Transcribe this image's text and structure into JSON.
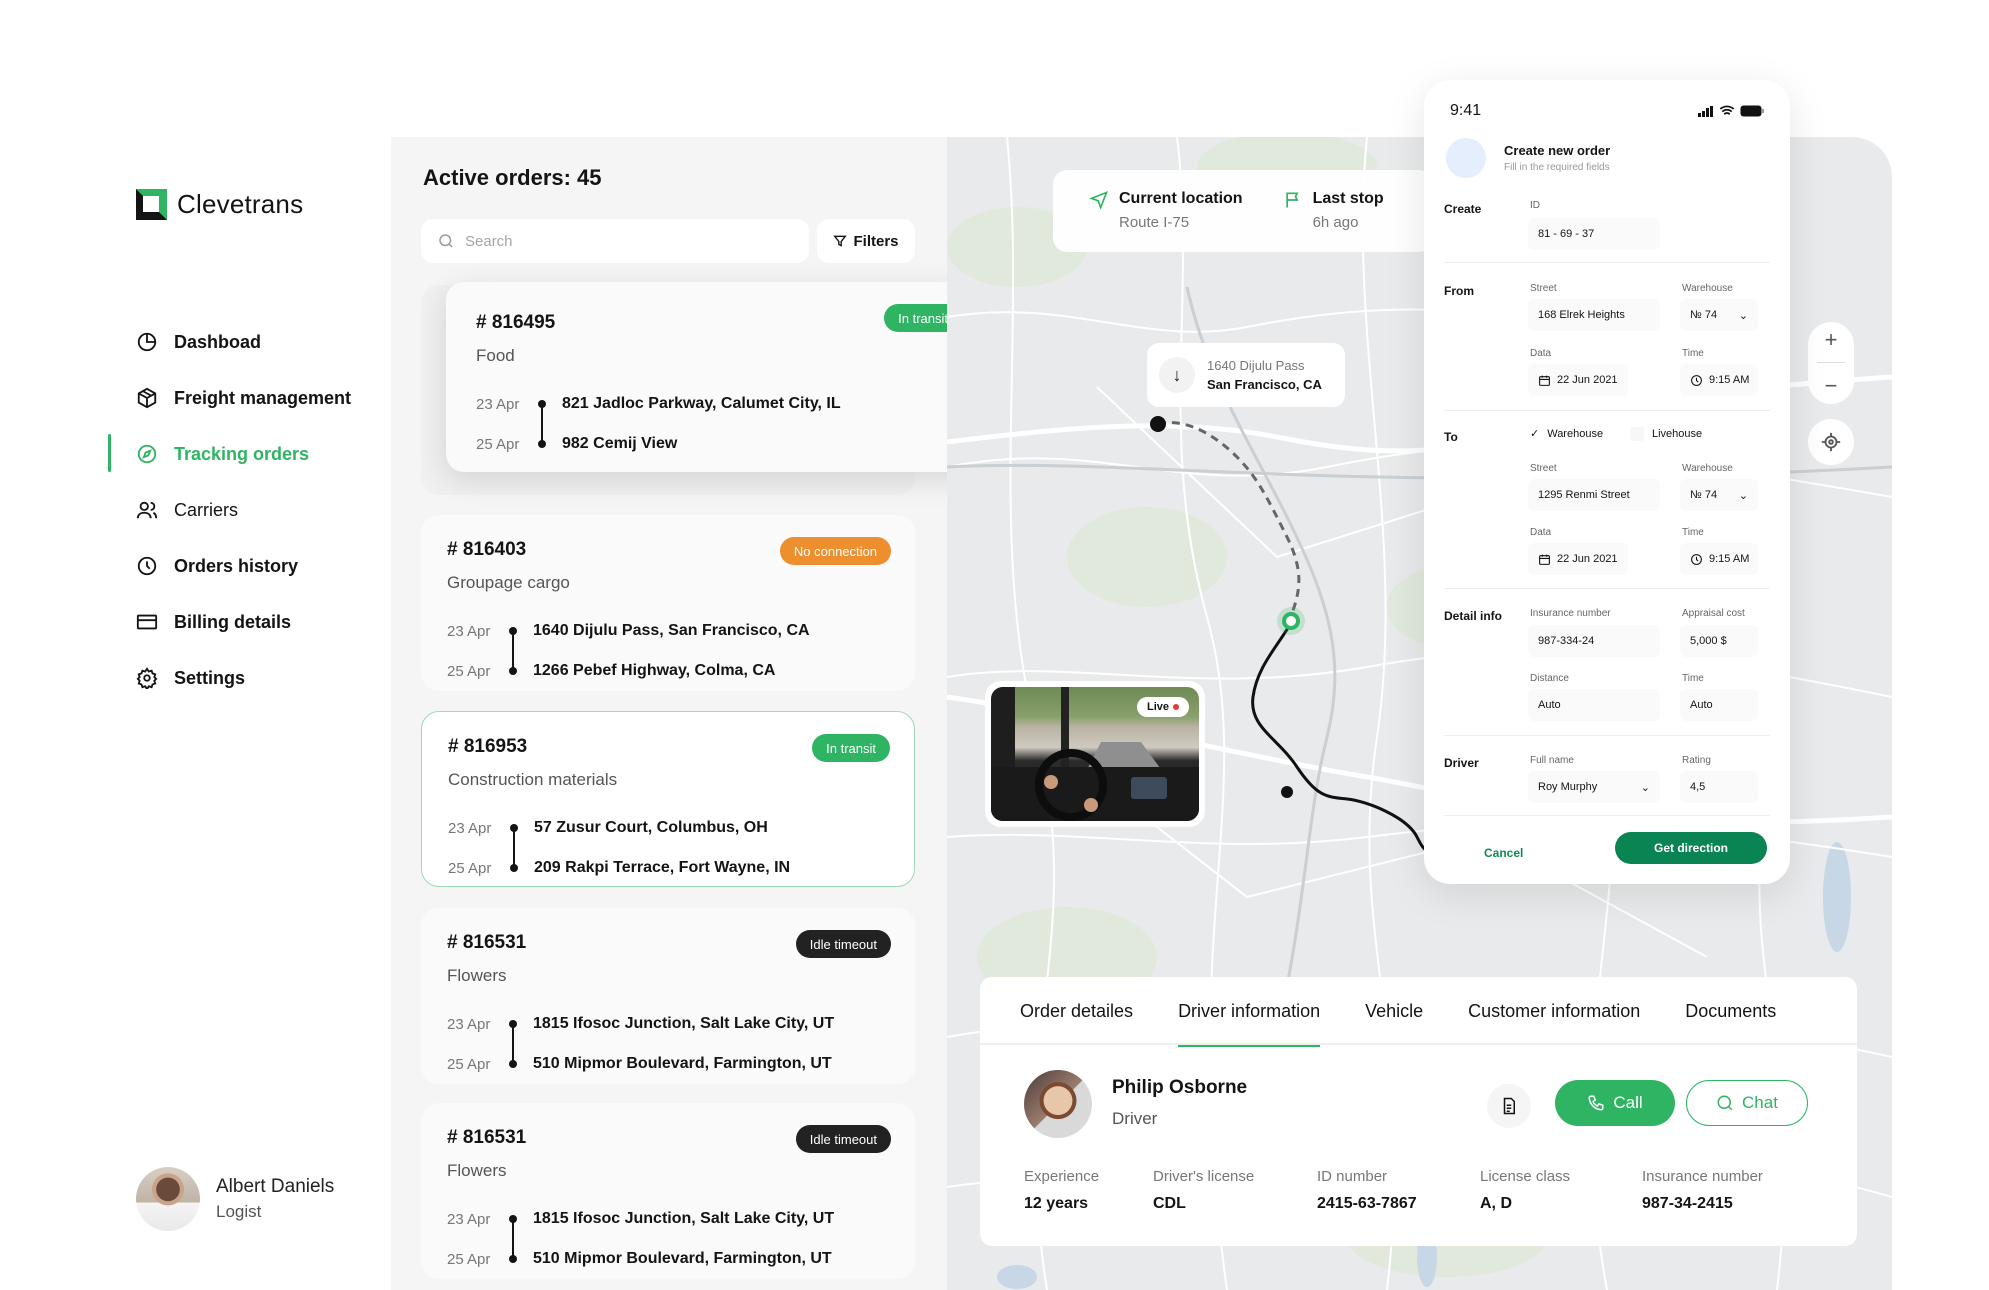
{
  "app": {
    "name": "Clevetrans",
    "brand_color": "#2fb463",
    "dark_color": "#141414"
  },
  "sidebar": {
    "items": [
      {
        "label": "Dashboad",
        "icon": "pie-chart-icon",
        "active": false
      },
      {
        "label": "Freight management",
        "icon": "box-icon",
        "active": false
      },
      {
        "label": "Tracking orders",
        "icon": "compass-icon",
        "active": true
      },
      {
        "label": "Carriers",
        "icon": "users-icon",
        "active": false
      },
      {
        "label": "Orders history",
        "icon": "clock-icon",
        "active": false
      },
      {
        "label": "Billing details",
        "icon": "credit-card-icon",
        "active": false
      },
      {
        "label": "Settings",
        "icon": "gear-icon",
        "active": false
      }
    ],
    "user": {
      "name": "Albert Daniels",
      "role": "Logist"
    }
  },
  "orders": {
    "title": "Active orders: 45",
    "search_placeholder": "Search",
    "search_value": "",
    "filters_label": "Filters",
    "list": [
      {
        "number": "# 816495",
        "cargo": "Food",
        "status": "In transit",
        "status_color": "#2fb463",
        "from_date": "23 Apr",
        "from_addr": "821 Jadloc Parkway, Calumet City, IL",
        "to_date": "25 Apr",
        "to_addr": "982 Cemij View"
      },
      {
        "number": "# 816403",
        "cargo": "Groupage cargo",
        "status": "No connection",
        "status_color": "#ed8f2f",
        "from_date": "23 Apr",
        "from_addr": "1640 Dijulu Pass, San Francisco, CA",
        "to_date": "25 Apr",
        "to_addr": "1266 Pebef Highway, Colma,  CA"
      },
      {
        "number": "# 816953",
        "cargo": "Construction materials",
        "status": "In transit",
        "status_color": "#2fb463",
        "from_date": "23 Apr",
        "from_addr": "57 Zusur Court, Columbus, OH",
        "to_date": "25 Apr",
        "to_addr": "209 Rakpi Terrace, Fort Wayne, IN"
      },
      {
        "number": "# 816531",
        "cargo": "Flowers",
        "status": "Idle timeout",
        "status_color": "#222222",
        "from_date": "23 Apr",
        "from_addr": "1815 Ifosoc Junction, Salt Lake City, UT",
        "to_date": "25 Apr",
        "to_addr": "510 Mipmor Boulevard, Farmington, UT"
      },
      {
        "number": "# 816531",
        "cargo": "Flowers",
        "status": "Idle timeout",
        "status_color": "#222222",
        "from_date": "23 Apr",
        "from_addr": "1815 Ifosoc Junction, Salt Lake City, UT",
        "to_date": "25 Apr",
        "to_addr": "510 Mipmor Boulevard, Farmington, UT"
      }
    ]
  },
  "map": {
    "current_location": {
      "title": "Current location",
      "sub": "Route I-75"
    },
    "last_stop": {
      "title": "Last stop",
      "sub": "6h ago"
    },
    "pin": {
      "line1": "1640 Dijulu Pass",
      "line2": "San Francisco, CA"
    },
    "live_label": "Live",
    "zoom_in": "+",
    "zoom_out": "−"
  },
  "phone": {
    "time": "9:41",
    "title": "Create new order",
    "subtitle": "Fill in the required fields",
    "create": {
      "label": "Create",
      "id_label": "ID",
      "id_value": "81 - 69 - 37"
    },
    "from": {
      "label": "From",
      "street_label": "Street",
      "street_value": "168 Elrek Heights",
      "warehouse_label": "Warehouse",
      "warehouse_value": "№ 74",
      "date_label": "Data",
      "date_value": "22 Jun 2021",
      "time_label": "Time",
      "time_value": "9:15 AM"
    },
    "to": {
      "label": "To",
      "option_warehouse": "Warehouse",
      "option_livehouse": "Livehouse",
      "warehouse_checked": true,
      "street_label": "Street",
      "street_value": "1295 Renmi Street",
      "warehouse_label": "Warehouse",
      "warehouse_value": "№ 74",
      "date_label": "Data",
      "date_value": "22 Jun 2021",
      "time_label": "Time",
      "time_value": "9:15 AM"
    },
    "detail": {
      "label": "Detail info",
      "insurance_label": "Insurance number",
      "insurance_value": "987-334-24",
      "appraisal_label": "Appraisal cost",
      "appraisal_value": "5,000 $",
      "distance_label": "Distance",
      "distance_value": "Auto",
      "time_label": "Time",
      "time_value": "Auto"
    },
    "driver": {
      "label": "Driver",
      "name_label": "Full name",
      "name_value": "Roy Murphy",
      "rating_label": "Rating",
      "rating_value": "4,5"
    },
    "cancel_label": "Cancel",
    "submit_label": "Get direction"
  },
  "driver_panel": {
    "tabs": [
      "Order detailes",
      "Driver information",
      "Vehicle",
      "Customer information",
      "Documents"
    ],
    "active_tab": "Driver information",
    "name": "Philip Osborne",
    "role": "Driver",
    "call_label": "Call",
    "chat_label": "Chat",
    "stats": [
      {
        "label": "Experience",
        "value": "12 years"
      },
      {
        "label": "Driver's license",
        "value": "CDL"
      },
      {
        "label": "ID number",
        "value": "2415-63-7867"
      },
      {
        "label": "License class",
        "value": "A, D"
      },
      {
        "label": "Insurance number",
        "value": "987-34-2415"
      }
    ]
  }
}
